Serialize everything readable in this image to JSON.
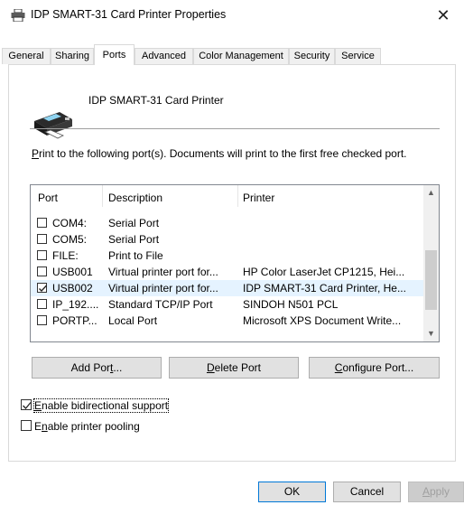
{
  "window": {
    "title": "IDP SMART-31 Card Printer Properties",
    "close_glyph": "✕"
  },
  "tabs": [
    {
      "label": "General"
    },
    {
      "label": "Sharing"
    },
    {
      "label": "Ports"
    },
    {
      "label": "Advanced"
    },
    {
      "label": "Color Management"
    },
    {
      "label": "Security"
    },
    {
      "label": "Service"
    }
  ],
  "active_tab": "Ports",
  "printer_name": "IDP SMART-31 Card Printer",
  "instructions": {
    "accel": "P",
    "text": "rint to the following port(s). Documents will print to the first free checked port."
  },
  "port_list": {
    "headers": {
      "port": "Port",
      "description": "Description",
      "printer": "Printer"
    },
    "rows": [
      {
        "port": "COM4:",
        "description": "Serial Port",
        "printer": "",
        "checked": false
      },
      {
        "port": "COM5:",
        "description": "Serial Port",
        "printer": "",
        "checked": false
      },
      {
        "port": "FILE:",
        "description": "Print to File",
        "printer": "",
        "checked": false
      },
      {
        "port": "USB001",
        "description": "Virtual printer port for...",
        "printer": "HP Color LaserJet CP1215, Hei...",
        "checked": false
      },
      {
        "port": "USB002",
        "description": "Virtual printer port for...",
        "printer": "IDP SMART-31 Card Printer, He...",
        "checked": true
      },
      {
        "port": "IP_192....",
        "description": "Standard TCP/IP Port",
        "printer": "SINDOH N501 PCL",
        "checked": false
      },
      {
        "port": "PORTP...",
        "description": "Local Port",
        "printer": "Microsoft XPS Document Write...",
        "checked": false
      }
    ]
  },
  "buttons": {
    "add_port": {
      "pre": "Add Por",
      "accel": "t",
      "post": "..."
    },
    "delete_port": {
      "pre": "",
      "accel": "D",
      "post": "elete Port"
    },
    "configure_port": {
      "pre": "",
      "accel": "C",
      "post": "onfigure Port..."
    },
    "ok": "OK",
    "cancel": "Cancel",
    "apply": {
      "pre": "",
      "accel": "A",
      "post": "pply"
    }
  },
  "options": {
    "bidirectional": {
      "accel": "E",
      "text": "nable bidirectional support",
      "checked": true
    },
    "pooling": {
      "pre": "E",
      "accel": "n",
      "text": "able printer pooling",
      "checked": false
    }
  },
  "colors": {
    "selection": "#e5f3ff",
    "accent": "#0078d7"
  }
}
